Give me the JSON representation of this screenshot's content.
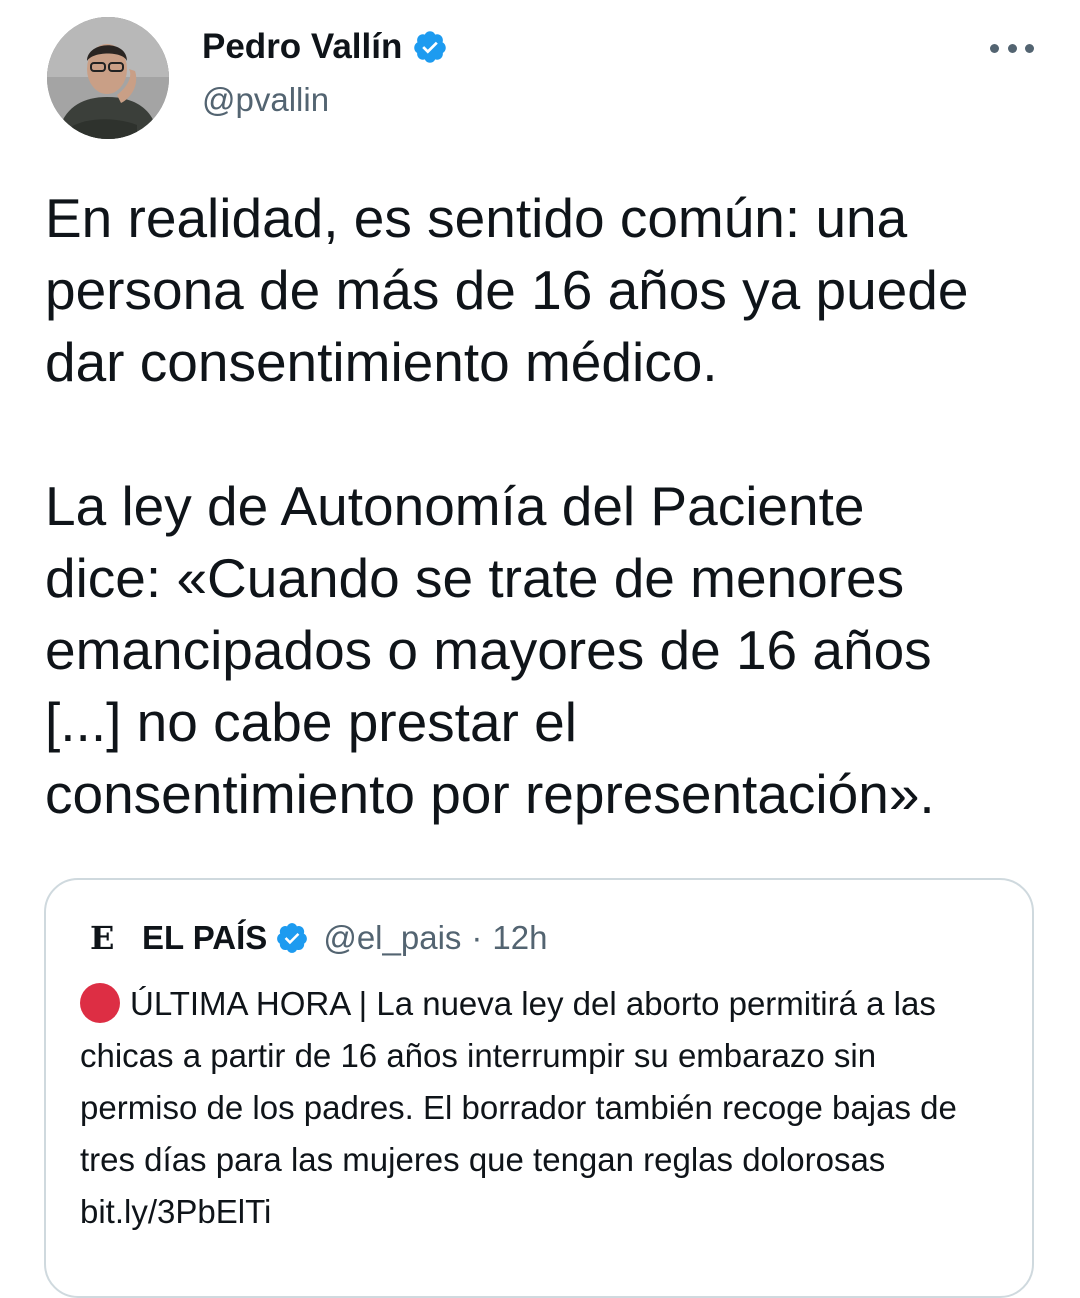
{
  "author": {
    "display_name": "Pedro Vallín",
    "handle": "@pvallin",
    "verified": true,
    "avatar_icon": "person-photo"
  },
  "more_icon": "more-horizontal-icon",
  "tweet": {
    "paragraphs": [
      "En realidad, es sentido común: una\npersona de más de 16 años ya puede\ndar consentimiento médico.",
      "La ley de Autonomía del Paciente\ndice: «Cuando se trate de menores\nemancipados o mayores de 16 años\n[...] no cabe prestar el\nconsentimiento por representación»."
    ]
  },
  "quoted_tweet": {
    "logo_letter": "E",
    "name": "EL PAÍS",
    "verified": true,
    "handle": "@el_pais",
    "separator": "·",
    "time": "12h",
    "text": "ÚLTIMA HORA | La nueva ley del aborto permitirá a las chicas a partir de 16 años interrumpir su embarazo sin permiso de los padres. El borrador también recoge bajas de tres días para las mujeres que tengan reglas dolorosas bit.ly/3PbElTi"
  },
  "colors": {
    "text": "#0f1419",
    "secondary": "#536471",
    "verified_blue": "#1d9bf0",
    "border": "#cfd9de",
    "red_circle": "#dd2e44"
  }
}
